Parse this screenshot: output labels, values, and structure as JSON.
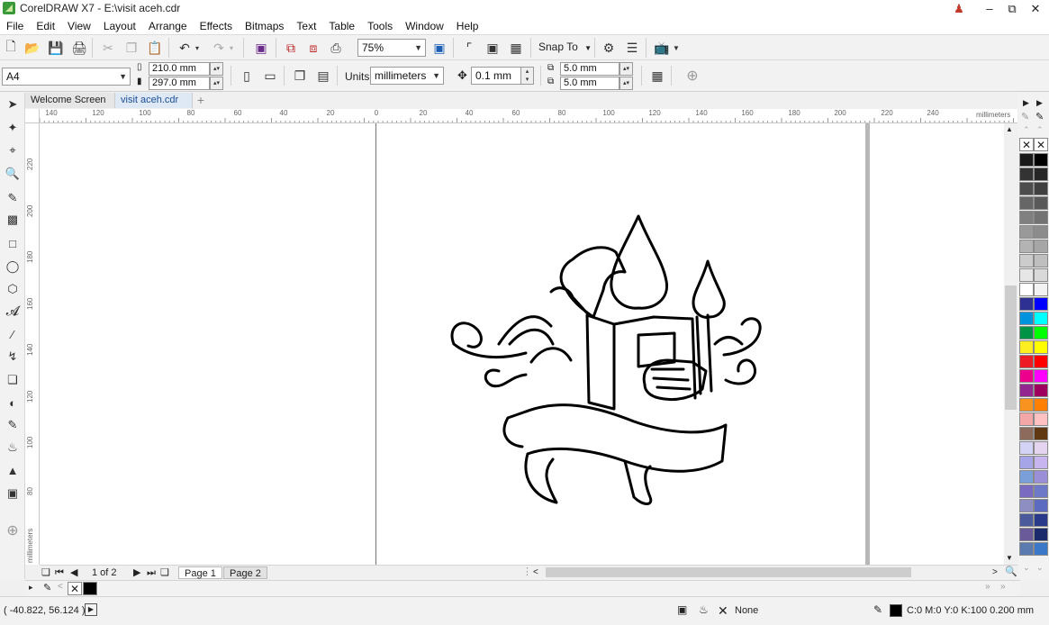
{
  "window": {
    "title": "CorelDRAW X7 - E:\\visit aceh.cdr"
  },
  "menu": [
    "File",
    "Edit",
    "View",
    "Layout",
    "Arrange",
    "Effects",
    "Bitmaps",
    "Text",
    "Table",
    "Tools",
    "Window",
    "Help"
  ],
  "toolbar": {
    "zoom_value": "75%",
    "snap_label": "Snap To"
  },
  "propbar": {
    "paper_size": "A4",
    "width": "210.0 mm",
    "height": "297.0 mm",
    "units_label": "Units:",
    "units_value": "millimeters",
    "nudge": "0.1 mm",
    "dup_x": "5.0 mm",
    "dup_y": "5.0 mm"
  },
  "tabs": [
    "Welcome Screen",
    "visit aceh.cdr"
  ],
  "ruler": {
    "h_ticks": [
      "140",
      "120",
      "100",
      "80",
      "60",
      "40",
      "20",
      "0",
      "20",
      "40",
      "60",
      "80",
      "100",
      "120",
      "140",
      "160",
      "180",
      "200",
      "220",
      "240"
    ],
    "h_unit": "millimeters",
    "v_ticks": [
      "220",
      "200",
      "180",
      "160",
      "140",
      "120",
      "100",
      "80"
    ],
    "v_unit": "millimeters"
  },
  "pages": {
    "counter": "1 of 2",
    "tabs": [
      "Page 1",
      "Page 2"
    ]
  },
  "status": {
    "coords": "( -40.822, 56.124 )",
    "fill_label": "None",
    "outline_info": "C:0 M:0 Y:0 K:100  0.200 mm"
  },
  "palette_colors": [
    [
      "#1a1a1a",
      "#000000"
    ],
    [
      "#333333",
      "#262626"
    ],
    [
      "#4d4d4d",
      "#404040"
    ],
    [
      "#666666",
      "#595959"
    ],
    [
      "#808080",
      "#737373"
    ],
    [
      "#999999",
      "#8c8c8c"
    ],
    [
      "#b3b3b3",
      "#a6a6a6"
    ],
    [
      "#cccccc",
      "#bfbfbf"
    ],
    [
      "#e6e6e6",
      "#d9d9d9"
    ],
    [
      "#ffffff",
      "#f2f2f2"
    ],
    [
      "#2e3192",
      "#0000ff"
    ],
    [
      "#0093dd",
      "#00ffff"
    ],
    [
      "#009245",
      "#00ff00"
    ],
    [
      "#fcee21",
      "#ffff00"
    ],
    [
      "#ed1c24",
      "#ff0000"
    ],
    [
      "#ec008c",
      "#ff00ff"
    ],
    [
      "#93278f",
      "#9e005d"
    ],
    [
      "#f7931e",
      "#ff7f00"
    ],
    [
      "#f4a7a7",
      "#ffc1c1"
    ],
    [
      "#8c6b5d",
      "#603913"
    ],
    [
      "#d3d3f5",
      "#e5d4f0"
    ],
    [
      "#a5a5e8",
      "#c6b5ee"
    ],
    [
      "#7b9fd8",
      "#9b8fd8"
    ],
    [
      "#7a6ac0",
      "#6e7ac8"
    ],
    [
      "#8e8ec2",
      "#5c6bc0"
    ],
    [
      "#4a5a9a",
      "#2a3a8a"
    ],
    [
      "#6a5a9a",
      "#1a2a6a"
    ],
    [
      "#5a7ab0",
      "#3b78c8"
    ]
  ]
}
